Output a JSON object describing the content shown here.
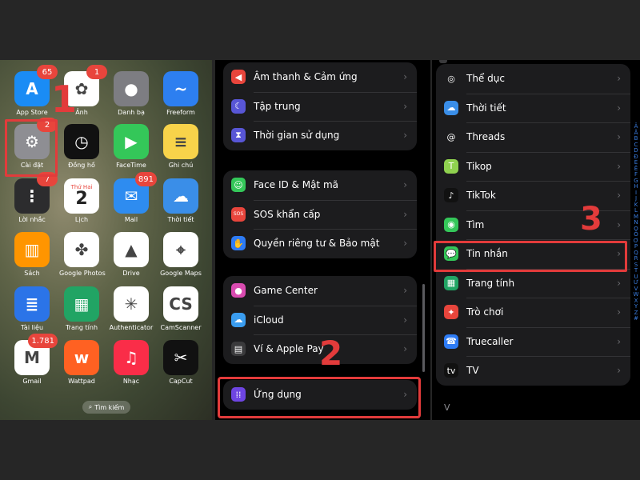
{
  "home": {
    "apps": [
      {
        "label": "App Store",
        "icon": "app-store-icon",
        "bg": "#1a8cf5",
        "glyph": "A",
        "badge": "65"
      },
      {
        "label": "Ảnh",
        "icon": "photos-icon",
        "bg": "#ffffff",
        "glyph": "✿",
        "badge": "1"
      },
      {
        "label": "Danh bạ",
        "icon": "contacts-icon",
        "bg": "#7d7d82",
        "glyph": "●",
        "badge": ""
      },
      {
        "label": "Freeform",
        "icon": "freeform-icon",
        "bg": "#2d7ff0",
        "glyph": "~",
        "badge": ""
      },
      {
        "label": "Cài đặt",
        "icon": "settings-gear-icon",
        "bg": "#8e8e93",
        "glyph": "⚙",
        "badge": "2"
      },
      {
        "label": "Đồng hồ",
        "icon": "clock-icon",
        "bg": "#111111",
        "glyph": "◷",
        "badge": ""
      },
      {
        "label": "FaceTime",
        "icon": "facetime-icon",
        "bg": "#34c759",
        "glyph": "▶",
        "badge": ""
      },
      {
        "label": "Ghi chú",
        "icon": "notes-icon",
        "bg": "#f8d34a",
        "glyph": "≡",
        "badge": ""
      },
      {
        "label": "Lời nhắc",
        "icon": "reminders-icon",
        "bg": "#2c2c2e",
        "glyph": "⋮",
        "badge": "7"
      },
      {
        "label": "Lịch",
        "icon": "calendar-icon",
        "bg": "#ffffff",
        "glyph": "2",
        "badge": ""
      },
      {
        "label": "Mail",
        "icon": "mail-icon",
        "bg": "#2e8cf0",
        "glyph": "✉",
        "badge": "891"
      },
      {
        "label": "Thời tiết",
        "icon": "weather-icon",
        "bg": "#3a8ee8",
        "glyph": "☁",
        "badge": ""
      },
      {
        "label": "Sách",
        "icon": "books-icon",
        "bg": "#ff9500",
        "glyph": "▥",
        "badge": ""
      },
      {
        "label": "Google Photos",
        "icon": "google-photos-icon",
        "bg": "#ffffff",
        "glyph": "✤",
        "badge": ""
      },
      {
        "label": "Drive",
        "icon": "google-drive-icon",
        "bg": "#ffffff",
        "glyph": "▲",
        "badge": ""
      },
      {
        "label": "Google Maps",
        "icon": "google-maps-icon",
        "bg": "#ffffff",
        "glyph": "⌖",
        "badge": ""
      },
      {
        "label": "Tài liệu",
        "icon": "google-docs-icon",
        "bg": "#2b74e8",
        "glyph": "≣",
        "badge": ""
      },
      {
        "label": "Trang tính",
        "icon": "google-sheets-icon",
        "bg": "#21a464",
        "glyph": "▦",
        "badge": ""
      },
      {
        "label": "Authenticator",
        "icon": "authenticator-icon",
        "bg": "#ffffff",
        "glyph": "✳",
        "badge": ""
      },
      {
        "label": "CamScanner",
        "icon": "camscanner-icon",
        "bg": "#ffffff",
        "glyph": "CS",
        "badge": ""
      },
      {
        "label": "Gmail",
        "icon": "gmail-icon",
        "bg": "#ffffff",
        "glyph": "M",
        "badge": "1.781"
      },
      {
        "label": "Wattpad",
        "icon": "wattpad-icon",
        "bg": "#ff6122",
        "glyph": "w",
        "badge": ""
      },
      {
        "label": "Nhạc",
        "icon": "music-icon",
        "bg": "#fa2d48",
        "glyph": "♫",
        "badge": ""
      },
      {
        "label": "CapCut",
        "icon": "capcut-icon",
        "bg": "#111111",
        "glyph": "✂",
        "badge": ""
      }
    ],
    "calendar_day": "Thứ Hai",
    "search_label": "Tìm kiếm",
    "step1": "1"
  },
  "settings": {
    "groups": [
      {
        "items": [
          {
            "label": "Âm thanh & Cảm ứng",
            "icon": "speaker-icon",
            "color": "#e8453c",
            "glyph": "◀"
          },
          {
            "label": "Tập trung",
            "icon": "moon-icon",
            "color": "#5856d6",
            "glyph": "☾"
          },
          {
            "label": "Thời gian sử dụng",
            "icon": "hourglass-icon",
            "color": "#5856d6",
            "glyph": "⧗"
          }
        ]
      },
      {
        "items": [
          {
            "label": "Face ID & Mật mã",
            "icon": "face-id-icon",
            "color": "#34c759",
            "glyph": "☺"
          },
          {
            "label": "SOS khẩn cấp",
            "icon": "sos-icon",
            "color": "#e8453c",
            "glyph": "SOS"
          },
          {
            "label": "Quyền riêng tư & Bảo mật",
            "icon": "hand-icon",
            "color": "#2e7cf6",
            "glyph": "✋"
          }
        ]
      },
      {
        "items": [
          {
            "label": "Game Center",
            "icon": "game-center-icon",
            "color": "#d94bb0",
            "glyph": "●"
          },
          {
            "label": "iCloud",
            "icon": "icloud-icon",
            "color": "#3a9df0",
            "glyph": "☁"
          },
          {
            "label": "Ví & Apple Pay",
            "icon": "wallet-icon",
            "color": "#3a3a3c",
            "glyph": "▤"
          }
        ]
      },
      {
        "items": [
          {
            "label": "Ứng dụng",
            "icon": "apps-grid-icon",
            "color": "#6e45e2",
            "glyph": "⁞⁞"
          }
        ]
      }
    ],
    "step2": "2"
  },
  "apps_list": {
    "items": [
      {
        "label": "Thể dục",
        "icon": "fitness-icon",
        "color": "#1c1c1e",
        "glyph": "◎"
      },
      {
        "label": "Thời tiết",
        "icon": "weather-icon",
        "color": "#3a8ee8",
        "glyph": "☁"
      },
      {
        "label": "Threads",
        "icon": "threads-icon",
        "color": "#1c1c1e",
        "glyph": "@"
      },
      {
        "label": "Tikop",
        "icon": "tikop-icon",
        "color": "#8fd14f",
        "glyph": "T"
      },
      {
        "label": "TikTok",
        "icon": "tiktok-icon",
        "color": "#111111",
        "glyph": "♪"
      },
      {
        "label": "Tìm",
        "icon": "find-my-icon",
        "color": "#34c759",
        "glyph": "◉"
      },
      {
        "label": "Tin nhắn",
        "icon": "messages-icon",
        "color": "#34c759",
        "glyph": "💬"
      },
      {
        "label": "Trang tính",
        "icon": "google-sheets-icon",
        "color": "#21a464",
        "glyph": "▦"
      },
      {
        "label": "Trò chơi",
        "icon": "games-icon",
        "color": "#e8453c",
        "glyph": "✦"
      },
      {
        "label": "Truecaller",
        "icon": "truecaller-icon",
        "color": "#2e7cf6",
        "glyph": "☎"
      },
      {
        "label": "TV",
        "icon": "apple-tv-icon",
        "color": "#111111",
        "glyph": "tv"
      }
    ],
    "index_letters": [
      "Â",
      "Ă",
      "B",
      "C",
      "D",
      "Đ",
      "E",
      "Ê",
      "F",
      "G",
      "H",
      "I",
      "J",
      "K",
      "L",
      "M",
      "N",
      "O",
      "Ô",
      "Ơ",
      "P",
      "Q",
      "R",
      "S",
      "T",
      "U",
      "Ư",
      "V",
      "W",
      "X",
      "Y",
      "Z",
      "#"
    ],
    "section_v": "V",
    "step3": "3"
  },
  "colors": {
    "highlight": "#e23b3b",
    "index_blue": "#3a7de0"
  }
}
